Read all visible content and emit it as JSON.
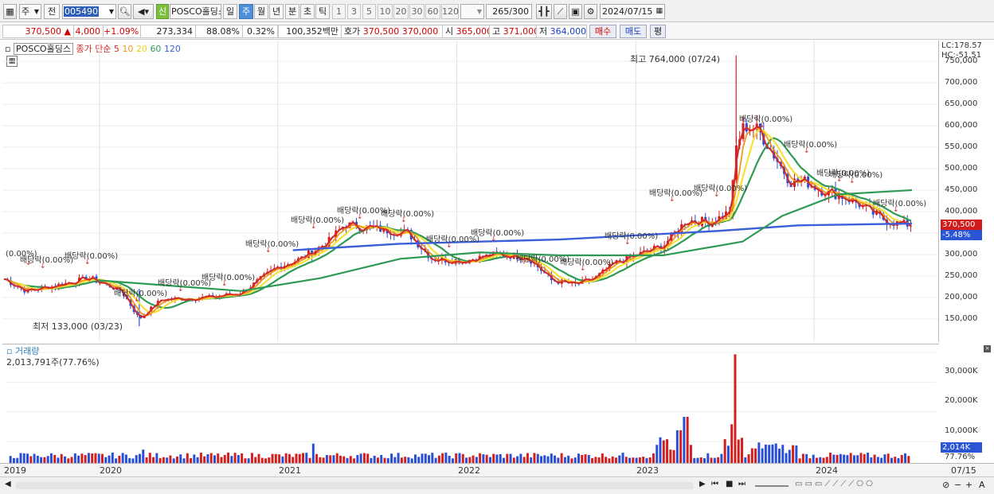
{
  "toolbar": {
    "market_label": "주",
    "prev_label": "전",
    "stock_code": "005490",
    "stock_name": "POSCO홀딩스",
    "badge": "신",
    "periods": [
      "일",
      "주",
      "월",
      "년",
      "분",
      "초",
      "틱"
    ],
    "active_period": "주",
    "intervals": [
      "1",
      "3",
      "5",
      "10",
      "20",
      "30",
      "60",
      "120"
    ],
    "count": "265",
    "count_max": "/300",
    "date": "2024/07/15"
  },
  "quote": {
    "price": "370,500",
    "change_arrow": "▲",
    "change": "4,000",
    "change_pct": "+1.09%",
    "volume": "273,334",
    "vol_ratio": "88.08%",
    "turnover": "0.32%",
    "amount": "100,352백만",
    "hoga_label": "호가",
    "hoga_ask": "370,500",
    "hoga_bid": "370,000",
    "open_label": "시",
    "open": "365,000",
    "high_label": "고",
    "high": "371,000",
    "low_label": "저",
    "low": "364,000",
    "buy_label": "매수",
    "sell_label": "매도",
    "eval_label": "평"
  },
  "legend": {
    "name": "POSCO홀딩스",
    "ma_label": "종가 단순 5",
    "ma10": "10",
    "ma20": "20",
    "ma60": "60",
    "ma120": "120"
  },
  "colors": {
    "ma5": "#d42a2a",
    "ma10": "#ef9a1c",
    "ma20": "#f2e23a",
    "ma60": "#2f9a56",
    "ma120": "#3a5fd8",
    "up": "#d41f1f",
    "down": "#2a4fd6"
  },
  "right_axis": {
    "lc": "LC:178.57",
    "hc": "HC:-51.51",
    "price_ticks": [
      "750,000",
      "700,000",
      "650,000",
      "600,000",
      "550,000",
      "500,000",
      "450,000",
      "400,000",
      "350,000",
      "300,000",
      "250,000",
      "200,000",
      "150,000"
    ],
    "current_price": "370,500",
    "current_pct": "-5.48%",
    "volume_ticks": [
      "30,000K",
      "20,000K",
      "10,000K"
    ],
    "current_volume": "2,014K",
    "volume_pct": "77.76%"
  },
  "annotations": {
    "high": "최고 764,000 (07/24)",
    "low": "최저 133,000 (03/23)",
    "dividend": "배당락(0.00%)",
    "dividend_partial": "(0.00%)"
  },
  "volume_pane": {
    "label": "거래량",
    "value": "2,013,791주(77.76%)"
  },
  "x_axis": {
    "labels": [
      "2019",
      "2020",
      "2021",
      "2022",
      "2023",
      "2024",
      "07/15"
    ]
  },
  "chart_data": {
    "type": "candlestick",
    "title": "POSCO홀딩스",
    "ylim": [
      110000,
      790000
    ],
    "x": [
      "2019",
      "2020",
      "2021",
      "2022",
      "2023",
      "2024",
      "07/15"
    ],
    "series": [
      {
        "name": "5",
        "values": [
          235000,
          230000,
          175000,
          190000,
          260000,
          360000,
          370000,
          290000,
          280000,
          240000,
          300000,
          370000,
          560000,
          470000,
          440000,
          380000,
          370500
        ]
      },
      {
        "name": "120",
        "values": [
          250000,
          245000,
          230000,
          235000,
          240000,
          250000,
          262000,
          272000,
          280000,
          284000,
          290000,
          300000,
          325000,
          355000,
          370000,
          372000,
          374000
        ]
      }
    ],
    "high": 764000,
    "low": 133000,
    "last": 370500
  }
}
